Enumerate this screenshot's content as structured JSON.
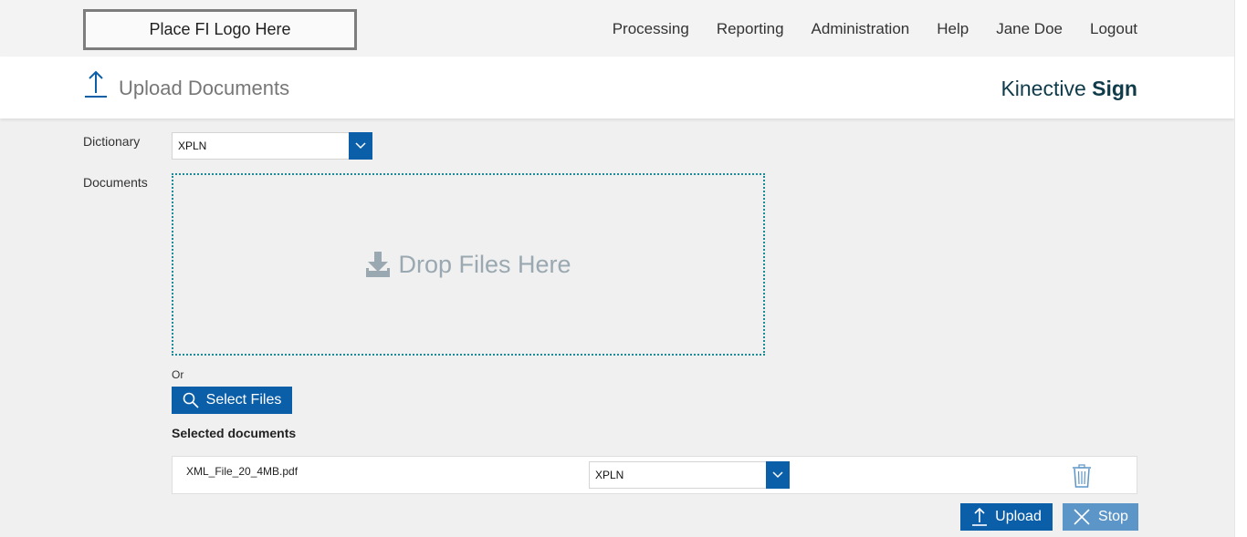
{
  "header": {
    "logo_text": "Place FI Logo Here",
    "nav": [
      "Processing",
      "Reporting",
      "Administration",
      "Help",
      "Jane Doe",
      "Logout"
    ]
  },
  "subheader": {
    "title": "Upload Documents",
    "title_icon": "upload-arrow-icon",
    "brand_light": "Kinective",
    "brand_bold": "Sign"
  },
  "form": {
    "dictionary_label": "Dictionary",
    "dictionary_value": "XPLN",
    "documents_label": "Documents",
    "drop_text": "Drop Files Here",
    "or_text": "Or",
    "select_files_label": "Select Files",
    "selected_title": "Selected documents"
  },
  "files": [
    {
      "name": "XML_File_20_4MB.pdf",
      "dictionary": "XPLN"
    }
  ],
  "actions": {
    "upload_label": "Upload",
    "stop_label": "Stop"
  },
  "colors": {
    "primary": "#0b5ea8",
    "stop": "#5c95c7",
    "dropzone_border": "#1a8a96",
    "brand": "#0f3b4a"
  }
}
